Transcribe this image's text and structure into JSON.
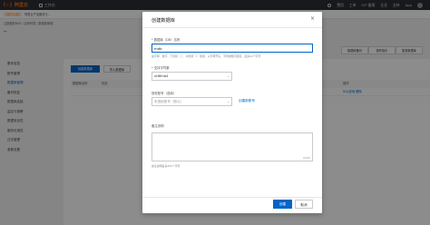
{
  "topbar": {
    "logo_mark": "(-)",
    "logo_text": "阿里云",
    "workspace": "工作台",
    "nav": [
      "费用",
      "工单",
      "ICP 备案",
      "企业",
      "支持",
      "App"
    ]
  },
  "notice": {
    "tag": "【官方公告】",
    "text": "阿里云产品服务与…"
  },
  "breadcrumb": "云数据库RDS / 实例列表 / 数据库管理",
  "page_head": {
    "back": "←",
    "title": ""
  },
  "sidebar": {
    "items": [
      {
        "label": "基本信息",
        "active": false
      },
      {
        "label": "账号管理",
        "active": false
      },
      {
        "label": "数据库管理",
        "active": true
      },
      {
        "label": "备份恢复",
        "active": false
      },
      {
        "label": "数据库连接",
        "active": false
      },
      {
        "label": "监控与报警",
        "active": false
      },
      {
        "label": "数据安全性",
        "active": false
      },
      {
        "label": "服务可用性",
        "active": false
      },
      {
        "label": "日志管理",
        "active": false
      },
      {
        "label": "参数设置",
        "active": false
      }
    ]
  },
  "main": {
    "btn_create": "创建数据库",
    "btn_import": "导入数据库",
    "headers": [
      "数据库名称",
      "状态",
      "备注说明",
      "操作"
    ],
    "row_actions": "SQL查询 删除",
    "right_tabs": [
      "数据库备份",
      "操作指引",
      "登录数据库"
    ]
  },
  "modal": {
    "title": "创建数据库",
    "close": "×",
    "db_name_label": "数据库（DB）名称",
    "db_name_value": "mdb",
    "db_name_help": "由字母、数字、下划线（_）、中划线（-）组成，以字母开头，字母或数字结尾，最多64个字符",
    "charset_label": "支持字符集",
    "charset_value": "utf8mb4",
    "account_label": "授权账号",
    "account_optional": "（选填）",
    "account_placeholder": "未授权账号（默认）",
    "create_account": "创建新账号",
    "remark_label": "备注说明",
    "counter": "0/256",
    "remark_help": "备注说明最多256个字符",
    "ok": "创建",
    "cancel": "取消"
  }
}
